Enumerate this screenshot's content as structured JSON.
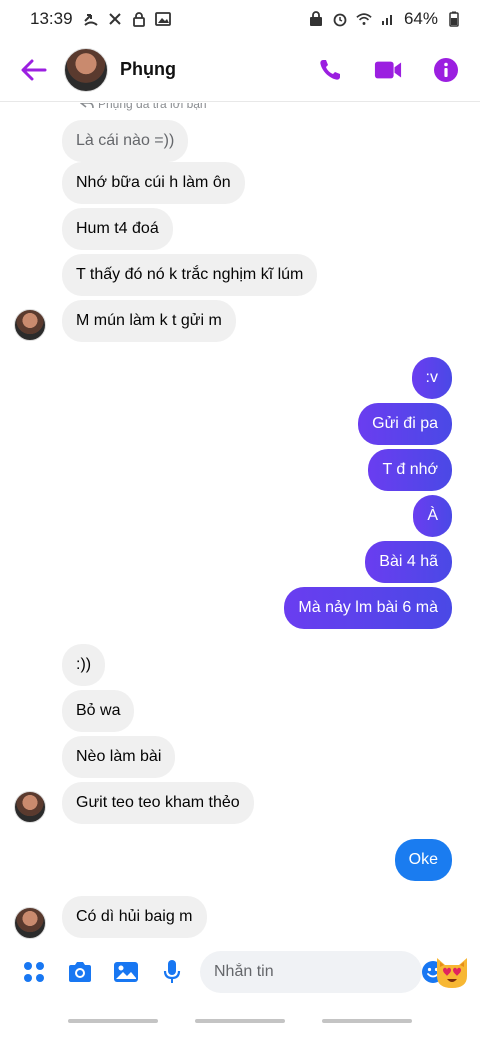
{
  "status_bar": {
    "time": "13:39",
    "battery": "64%"
  },
  "header": {
    "contact_name": "Phụng",
    "accent_color": "#9b1fe0"
  },
  "conversation": {
    "reply_hint": "Phụng đã trả lời bạn",
    "messages": [
      {
        "side": "in",
        "text": "Là cái nào =))"
      },
      {
        "side": "in",
        "text": "Nhớ bữa cúi h làm ôn"
      },
      {
        "side": "in",
        "text": "Hum t4 đoá"
      },
      {
        "side": "in",
        "text": "T thấy đó nó k trắc nghịm kĩ lúm"
      },
      {
        "side": "in",
        "text": "M mún làm k t gửi m"
      },
      {
        "side": "out",
        "text": ":v"
      },
      {
        "side": "out",
        "text": "Gửi đi pa"
      },
      {
        "side": "out",
        "text": "T đ nhớ"
      },
      {
        "side": "out",
        "text": "À"
      },
      {
        "side": "out",
        "text": "Bài 4 hã"
      },
      {
        "side": "out",
        "text": "Mà nảy lm bài 6 mà"
      },
      {
        "side": "in",
        "text": ":))"
      },
      {
        "side": "in",
        "text": "Bỏ wa"
      },
      {
        "side": "in",
        "text": "Nèo làm bài"
      },
      {
        "side": "in",
        "text": "Gưit teo teo kham thẻo"
      },
      {
        "side": "out",
        "text": "Oke"
      },
      {
        "side": "in",
        "text": "Có dì hủi baig m"
      }
    ]
  },
  "composer": {
    "placeholder": "Nhắn tin"
  },
  "colors": {
    "outgoing_bubble": "#5a40e8",
    "outgoing_bubble_blue": "#1a7cf0",
    "incoming_bubble": "#f0f0f0",
    "icon_blue": "#1877f2"
  }
}
